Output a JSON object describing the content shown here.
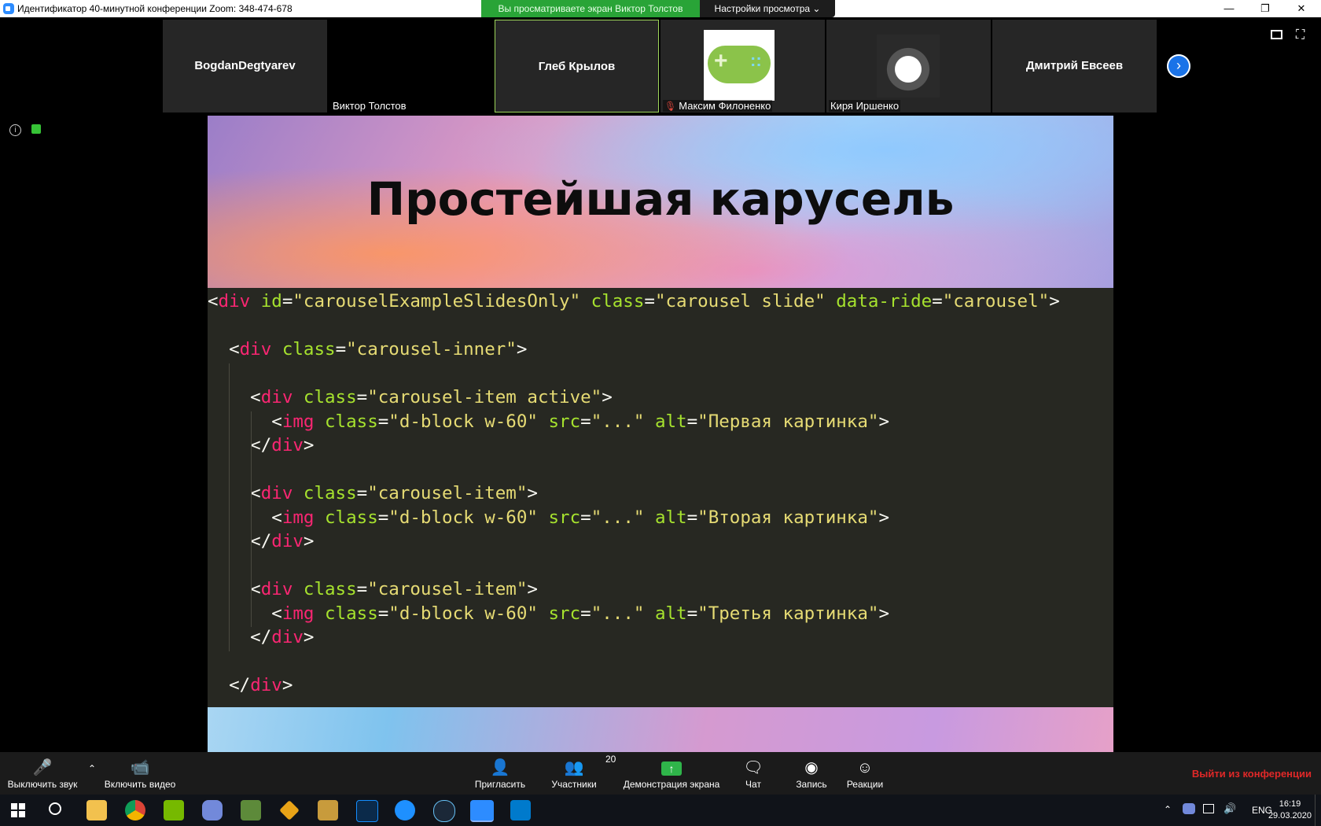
{
  "window": {
    "title": "Идентификатор 40-минутной конференции Zoom: 348-474-678",
    "viewing_banner": "Вы просматриваете экран Виктор Толстов",
    "view_options": "Настройки просмотра ⌄"
  },
  "gallery": {
    "tiles": [
      {
        "name": "BogdanDegtyarev",
        "label": ""
      },
      {
        "name": "",
        "label": "Виктор Толстов"
      },
      {
        "name": "Глеб Крылов",
        "label": ""
      },
      {
        "name": "",
        "label": "Максим Филоненко"
      },
      {
        "name": "",
        "label": "Киря Иршенко"
      },
      {
        "name": "Дмитрий Евсеев",
        "label": ""
      }
    ]
  },
  "slide": {
    "title": "Простейшая карусель",
    "code": [
      [
        {
          "t": "<",
          "c": "p"
        },
        {
          "t": "div",
          "c": "tag"
        },
        {
          "t": " ",
          "c": "p"
        },
        {
          "t": "id",
          "c": "attr"
        },
        {
          "t": "=",
          "c": "p"
        },
        {
          "t": "\"carouselExampleSlidesOnly\"",
          "c": "str"
        },
        {
          "t": " ",
          "c": "p"
        },
        {
          "t": "class",
          "c": "attr"
        },
        {
          "t": "=",
          "c": "p"
        },
        {
          "t": "\"carousel slide\"",
          "c": "str"
        },
        {
          "t": " ",
          "c": "p"
        },
        {
          "t": "data-ride",
          "c": "attr"
        },
        {
          "t": "=",
          "c": "p"
        },
        {
          "t": "\"carousel\"",
          "c": "str"
        },
        {
          "t": ">",
          "c": "p"
        }
      ],
      [],
      [
        {
          "t": "  <",
          "c": "p"
        },
        {
          "t": "div",
          "c": "tag"
        },
        {
          "t": " ",
          "c": "p"
        },
        {
          "t": "class",
          "c": "attr"
        },
        {
          "t": "=",
          "c": "p"
        },
        {
          "t": "\"carousel-inner\"",
          "c": "str"
        },
        {
          "t": ">",
          "c": "p"
        }
      ],
      [],
      [
        {
          "t": "    <",
          "c": "p"
        },
        {
          "t": "div",
          "c": "tag"
        },
        {
          "t": " ",
          "c": "p"
        },
        {
          "t": "class",
          "c": "attr"
        },
        {
          "t": "=",
          "c": "p"
        },
        {
          "t": "\"carousel-item active\"",
          "c": "str"
        },
        {
          "t": ">",
          "c": "p"
        }
      ],
      [
        {
          "t": "      <",
          "c": "p"
        },
        {
          "t": "img",
          "c": "tag"
        },
        {
          "t": " ",
          "c": "p"
        },
        {
          "t": "class",
          "c": "attr"
        },
        {
          "t": "=",
          "c": "p"
        },
        {
          "t": "\"d-block w-60\"",
          "c": "str"
        },
        {
          "t": " ",
          "c": "p"
        },
        {
          "t": "src",
          "c": "attr"
        },
        {
          "t": "=",
          "c": "p"
        },
        {
          "t": "\"...\"",
          "c": "str"
        },
        {
          "t": " ",
          "c": "p"
        },
        {
          "t": "alt",
          "c": "attr"
        },
        {
          "t": "=",
          "c": "p"
        },
        {
          "t": "\"Первая картинка\"",
          "c": "str"
        },
        {
          "t": ">",
          "c": "p"
        }
      ],
      [
        {
          "t": "    </",
          "c": "p"
        },
        {
          "t": "div",
          "c": "tag"
        },
        {
          "t": ">",
          "c": "p"
        }
      ],
      [],
      [
        {
          "t": "    <",
          "c": "p"
        },
        {
          "t": "div",
          "c": "tag"
        },
        {
          "t": " ",
          "c": "p"
        },
        {
          "t": "class",
          "c": "attr"
        },
        {
          "t": "=",
          "c": "p"
        },
        {
          "t": "\"carousel-item\"",
          "c": "str"
        },
        {
          "t": ">",
          "c": "p"
        }
      ],
      [
        {
          "t": "      <",
          "c": "p"
        },
        {
          "t": "img",
          "c": "tag"
        },
        {
          "t": " ",
          "c": "p"
        },
        {
          "t": "class",
          "c": "attr"
        },
        {
          "t": "=",
          "c": "p"
        },
        {
          "t": "\"d-block w-60\"",
          "c": "str"
        },
        {
          "t": " ",
          "c": "p"
        },
        {
          "t": "src",
          "c": "attr"
        },
        {
          "t": "=",
          "c": "p"
        },
        {
          "t": "\"...\"",
          "c": "str"
        },
        {
          "t": " ",
          "c": "p"
        },
        {
          "t": "alt",
          "c": "attr"
        },
        {
          "t": "=",
          "c": "p"
        },
        {
          "t": "\"Вторая картинка\"",
          "c": "str"
        },
        {
          "t": ">",
          "c": "p"
        }
      ],
      [
        {
          "t": "    </",
          "c": "p"
        },
        {
          "t": "div",
          "c": "tag"
        },
        {
          "t": ">",
          "c": "p"
        }
      ],
      [],
      [
        {
          "t": "    <",
          "c": "p"
        },
        {
          "t": "div",
          "c": "tag"
        },
        {
          "t": " ",
          "c": "p"
        },
        {
          "t": "class",
          "c": "attr"
        },
        {
          "t": "=",
          "c": "p"
        },
        {
          "t": "\"carousel-item\"",
          "c": "str"
        },
        {
          "t": ">",
          "c": "p"
        }
      ],
      [
        {
          "t": "      <",
          "c": "p"
        },
        {
          "t": "img",
          "c": "tag"
        },
        {
          "t": " ",
          "c": "p"
        },
        {
          "t": "class",
          "c": "attr"
        },
        {
          "t": "=",
          "c": "p"
        },
        {
          "t": "\"d-block w-60\"",
          "c": "str"
        },
        {
          "t": " ",
          "c": "p"
        },
        {
          "t": "src",
          "c": "attr"
        },
        {
          "t": "=",
          "c": "p"
        },
        {
          "t": "\"...\"",
          "c": "str"
        },
        {
          "t": " ",
          "c": "p"
        },
        {
          "t": "alt",
          "c": "attr"
        },
        {
          "t": "=",
          "c": "p"
        },
        {
          "t": "\"Третья картинка\"",
          "c": "str"
        },
        {
          "t": ">",
          "c": "p"
        }
      ],
      [
        {
          "t": "    </",
          "c": "p"
        },
        {
          "t": "div",
          "c": "tag"
        },
        {
          "t": ">",
          "c": "p"
        }
      ],
      [],
      [
        {
          "t": "  </",
          "c": "p"
        },
        {
          "t": "div",
          "c": "tag"
        },
        {
          "t": ">",
          "c": "p"
        }
      ]
    ]
  },
  "toolbar": {
    "mute_label": "Выключить звук",
    "video_label": "Включить видео",
    "invite_label": "Пригласить",
    "participants_label": "Участники",
    "participants_count": "20",
    "share_label": "Демонстрация экрана",
    "chat_label": "Чат",
    "record_label": "Запись",
    "reactions_label": "Реакции",
    "leave_label": "Выйти из конференции"
  },
  "taskbar": {
    "lang": "ENG",
    "time": "16:19",
    "date": "29.03.2020"
  },
  "colors": {
    "tag": "#f92672",
    "attr": "#a6e22e",
    "str": "#e6db74",
    "leave": "#e02828",
    "banner": "#29a437"
  },
  "icons": {
    "taskbar": [
      "windows-start-icon",
      "search-icon",
      "file-explorer-icon",
      "chrome-icon",
      "nvidia-icon",
      "discord-icon",
      "minecraft-icon",
      "app-icon",
      "league-icon",
      "battlenet-icon",
      "uplay-icon",
      "steam-icon",
      "zoom-icon",
      "vscode-icon"
    ]
  }
}
